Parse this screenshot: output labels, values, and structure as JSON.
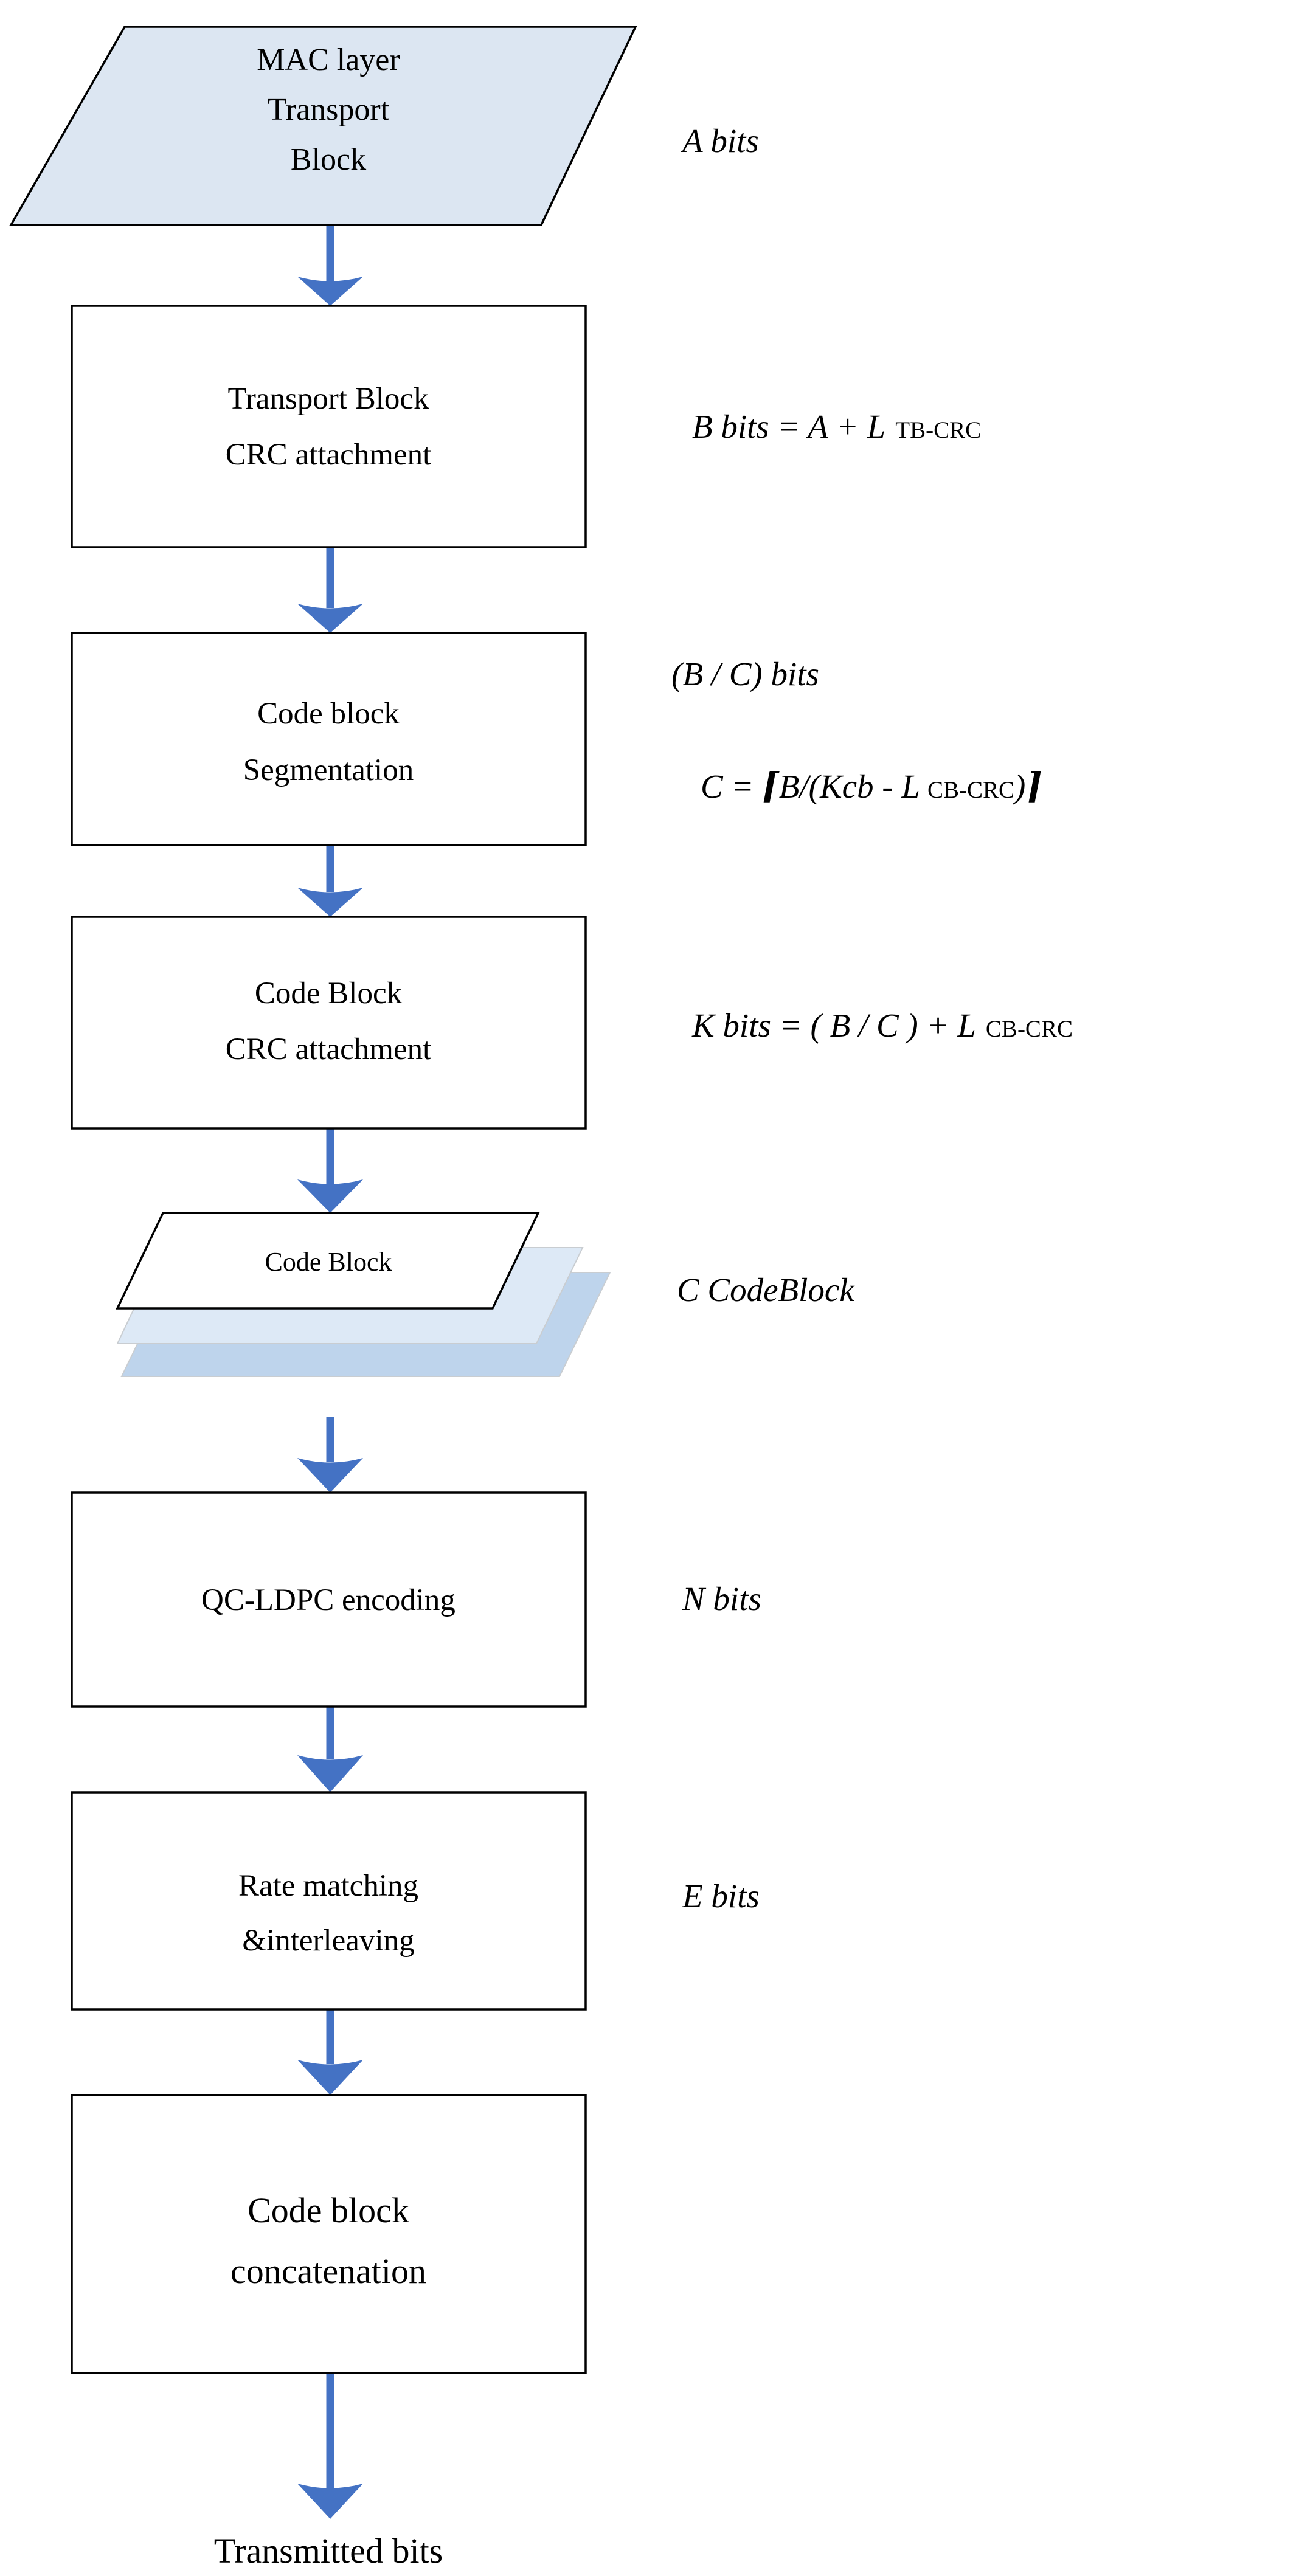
{
  "diagram": {
    "title": "5G NR Transport Block Processing Chain",
    "colors": {
      "arrow": "#4472C4",
      "data_shape_fill": "#DCE6F2",
      "code_block_mid_fill": "#DDE9F6",
      "code_block_back_fill": "#BED4EC",
      "box_fill": "#FFFFFF",
      "outline": "#000000",
      "text": "#000000"
    },
    "nodes": [
      {
        "id": "mac-transport-block",
        "type": "parallelogram",
        "lines": [
          "MAC layer",
          "Transport",
          "Block"
        ]
      },
      {
        "id": "tb-crc-attachment",
        "type": "process",
        "lines": [
          "Transport Block",
          "CRC attachment"
        ]
      },
      {
        "id": "code-block-segmentation",
        "type": "process",
        "lines": [
          "Code block",
          "Segmentation"
        ]
      },
      {
        "id": "cb-crc-attachment",
        "type": "process",
        "lines": [
          "Code Block",
          "CRC attachment"
        ]
      },
      {
        "id": "code-block-stack",
        "type": "stacked-parallelogram",
        "lines": [
          "Code Block"
        ]
      },
      {
        "id": "qc-ldpc-encoding",
        "type": "process",
        "lines": [
          "QC-LDPC encoding"
        ]
      },
      {
        "id": "rate-matching",
        "type": "process",
        "lines": [
          "Rate matching",
          "&interleaving"
        ]
      },
      {
        "id": "code-block-concatenation",
        "type": "process",
        "lines": [
          "Code block",
          "concatenation"
        ]
      },
      {
        "id": "transmitted-bits",
        "type": "terminal",
        "lines": [
          "Transmitted bits"
        ]
      }
    ],
    "annotations": [
      {
        "id": "annot-a-bits",
        "for": "mac-transport-block",
        "parts": [
          {
            "text": "A bits",
            "style": "italic"
          }
        ]
      },
      {
        "id": "annot-b-bits",
        "for": "tb-crc-attachment",
        "parts": [
          {
            "text": "B bits = A + L",
            "style": "italic"
          },
          {
            "text": "TB-CRC",
            "style": "sub"
          }
        ]
      },
      {
        "id": "annot-bc-bits",
        "for": "code-block-segmentation",
        "parts": [
          {
            "text": "(B / C) bits",
            "style": "italic"
          }
        ]
      },
      {
        "id": "annot-c-formula",
        "for": "code-block-segmentation",
        "parts": [
          {
            "text": "C = ",
            "style": "italic"
          },
          {
            "text": "⌈",
            "style": "ceil"
          },
          {
            "text": "B/(Kcb - L",
            "style": "italic"
          },
          {
            "text": "CB-CRC",
            "style": "sub"
          },
          {
            "text": ")",
            "style": "italic"
          },
          {
            "text": "⌉",
            "style": "ceil"
          }
        ]
      },
      {
        "id": "annot-k-bits",
        "for": "cb-crc-attachment",
        "parts": [
          {
            "text": "K bits = ( B / C ) + L",
            "style": "italic"
          },
          {
            "text": "CB-CRC",
            "style": "sub"
          }
        ]
      },
      {
        "id": "annot-c-codeblock",
        "for": "code-block-stack",
        "parts": [
          {
            "text": "C   CodeBlock",
            "style": "italic"
          }
        ]
      },
      {
        "id": "annot-n-bits",
        "for": "qc-ldpc-encoding",
        "parts": [
          {
            "text": "N bits",
            "style": "italic"
          }
        ]
      },
      {
        "id": "annot-e-bits",
        "for": "rate-matching",
        "parts": [
          {
            "text": "E bits",
            "style": "italic"
          }
        ]
      }
    ],
    "labels": {
      "mac_l1": "MAC layer",
      "mac_l2": "Transport",
      "mac_l3": "Block",
      "tbcrc_l1": "Transport Block",
      "tbcrc_l2": "CRC attachment",
      "seg_l1": "Code block",
      "seg_l2": "Segmentation",
      "cbcrc_l1": "Code Block",
      "cbcrc_l2": "CRC attachment",
      "codeblock": "Code Block",
      "ldpc_l1": "QC-LDPC encoding",
      "rate_l1": "Rate matching",
      "rate_l2": "&interleaving",
      "concat_l1": "Code block",
      "concat_l2": "concatenation",
      "transmitted": "Transmitted bits",
      "a_bits": "A bits",
      "b_bits_main": "B bits = A + L",
      "b_bits_sub": "TB-CRC",
      "bc_bits": "(B / C) bits",
      "c_formula_p1": "C = ",
      "c_formula_ceil_open": "⌈",
      "c_formula_p2": "B/(Kcb - L",
      "c_formula_sub": "CB-CRC",
      "c_formula_p3": ")",
      "c_formula_ceil_close": "⌉",
      "k_bits_main": "K bits = ( B / C ) + L",
      "k_bits_sub": "CB-CRC",
      "c_codeblock": "C   CodeBlock",
      "n_bits": "N bits",
      "e_bits": "E bits"
    }
  }
}
